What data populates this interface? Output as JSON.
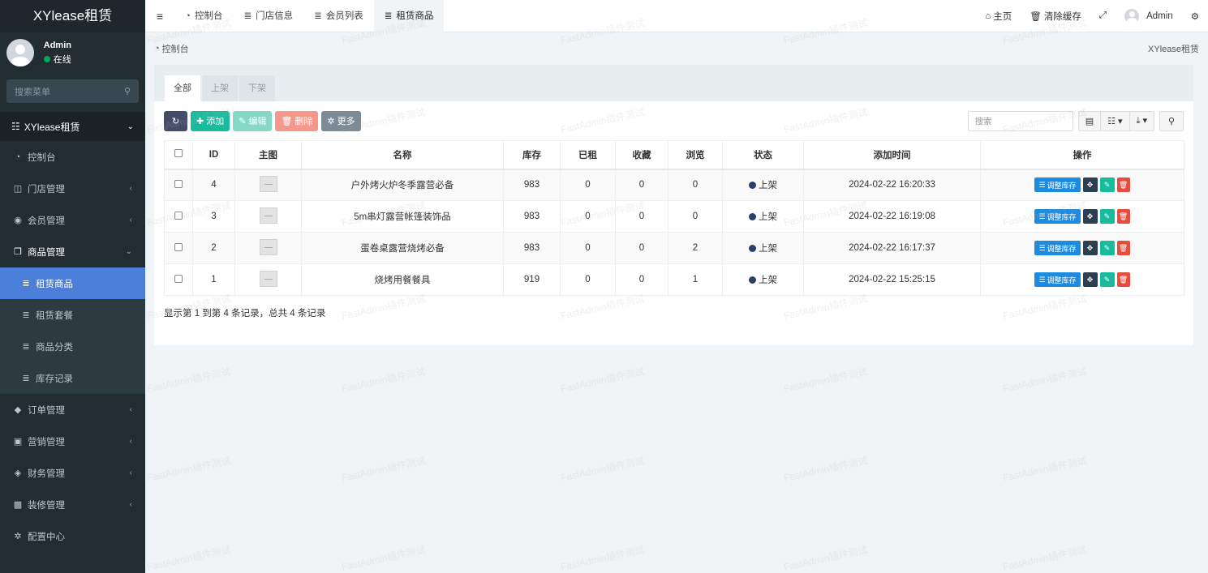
{
  "app": {
    "logo": "XYlease租赁"
  },
  "user": {
    "name": "Admin",
    "status": "在线"
  },
  "sidebar": {
    "search_placeholder": "搜索菜单",
    "header": "XYlease租赁",
    "items": [
      {
        "icon": "dashboard-icon",
        "glyph": "◔",
        "label": "控制台"
      },
      {
        "icon": "store-icon",
        "glyph": "◫",
        "label": "门店管理",
        "chevron": "‹"
      },
      {
        "icon": "user-circle-icon",
        "glyph": "◉",
        "label": "会员管理",
        "chevron": "‹"
      },
      {
        "icon": "clone-icon",
        "glyph": "❐",
        "label": "商品管理",
        "chevron": "⌄"
      },
      {
        "icon": "list-icon",
        "glyph": "≣",
        "label": "租赁商品"
      },
      {
        "icon": "list-icon",
        "glyph": "≣",
        "label": "租赁套餐"
      },
      {
        "icon": "list-icon",
        "glyph": "≣",
        "label": "商品分类"
      },
      {
        "icon": "list-icon",
        "glyph": "≣",
        "label": "库存记录"
      },
      {
        "icon": "cube-icon",
        "glyph": "◆",
        "label": "订单管理",
        "chevron": "‹"
      },
      {
        "icon": "ticket-icon",
        "glyph": "▣",
        "label": "营销管理",
        "chevron": "‹"
      },
      {
        "icon": "diamond-icon",
        "glyph": "◈",
        "label": "财务管理",
        "chevron": "‹"
      },
      {
        "icon": "image-icon",
        "glyph": "▩",
        "label": "装修管理",
        "chevron": "‹"
      },
      {
        "icon": "gear-icon",
        "glyph": "✲",
        "label": "配置中心"
      }
    ]
  },
  "topnav": {
    "tabs": [
      {
        "icon": "dashboard-icon",
        "glyph": "◔",
        "label": "控制台"
      },
      {
        "icon": "list-icon",
        "glyph": "≣",
        "label": "门店信息"
      },
      {
        "icon": "list-icon",
        "glyph": "≣",
        "label": "会员列表"
      },
      {
        "icon": "list-icon",
        "glyph": "≣",
        "label": "租赁商品"
      }
    ],
    "home": "主页",
    "clear_cache": "清除缓存",
    "admin": "Admin"
  },
  "breadcrumb": {
    "current": "控制台",
    "site": "XYlease租赁"
  },
  "filter_tabs": [
    "全部",
    "上架",
    "下架"
  ],
  "toolbar": {
    "add": "添加",
    "edit": "编辑",
    "delete": "删除",
    "more": "更多",
    "search_placeholder": "搜索"
  },
  "table": {
    "headers": [
      "ID",
      "主图",
      "名称",
      "库存",
      "已租",
      "收藏",
      "浏览",
      "状态",
      "添加时间",
      "操作"
    ],
    "rows": [
      {
        "id": "4",
        "name": "户外烤火炉冬季露营必备",
        "stock": "983",
        "rented": "0",
        "fav": "0",
        "views": "0",
        "status": "上架",
        "time": "2024-02-22 16:20:33"
      },
      {
        "id": "3",
        "name": "5m串灯露营帐篷装饰品",
        "stock": "983",
        "rented": "0",
        "fav": "0",
        "views": "0",
        "status": "上架",
        "time": "2024-02-22 16:19:08"
      },
      {
        "id": "2",
        "name": "蛋卷桌露营烧烤必备",
        "stock": "983",
        "rented": "0",
        "fav": "0",
        "views": "2",
        "status": "上架",
        "time": "2024-02-22 16:17:37"
      },
      {
        "id": "1",
        "name": "烧烤用餐餐具",
        "stock": "919",
        "rented": "0",
        "fav": "0",
        "views": "1",
        "status": "上架",
        "time": "2024-02-22 15:25:15"
      }
    ],
    "op_stock": "调整库存"
  },
  "footer_info": "显示第 1 到第 4 条记录，总共 4 条记录",
  "watermark": "FastAdmin插件测试",
  "colors": {
    "sidebar": "#222d32",
    "active": "#4b7fd9",
    "add": "#18bc9c",
    "delete": "#e74c3c"
  }
}
